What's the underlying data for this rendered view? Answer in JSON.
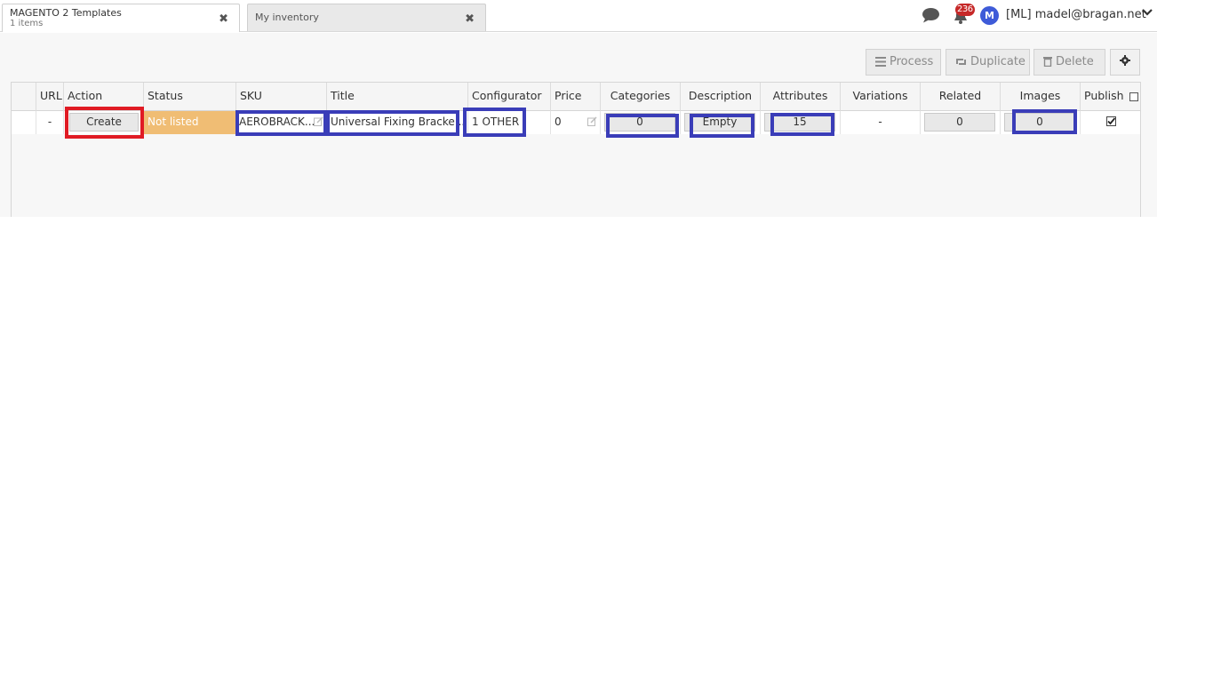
{
  "tabs": [
    {
      "title": "MAGENTO 2 Templates",
      "subtitle": "1 items"
    },
    {
      "title": "My inventory"
    }
  ],
  "header": {
    "notification_count": "236",
    "avatar_initial": "M",
    "user_label": "[ML] madel@bragan.net"
  },
  "toolbar": {
    "process_label": "Process",
    "duplicate_label": "Duplicate",
    "delete_label": "Delete"
  },
  "columns": {
    "url": "URL",
    "action": "Action",
    "status": "Status",
    "sku": "SKU",
    "title": "Title",
    "configurator": "Configurator",
    "price": "Price",
    "categories": "Categories",
    "description": "Description",
    "attributes": "Attributes",
    "variations": "Variations",
    "related": "Related",
    "images": "Images",
    "publish": "Publish"
  },
  "rows": [
    {
      "url": "-",
      "action": "Create",
      "status": "Not listed",
      "sku": "AEROBRACK...",
      "title": "Universal Fixing Bracke...",
      "configurator": "1 OTHER",
      "price": "0",
      "categories": "0",
      "description": "Empty",
      "attributes": "15",
      "variations": "-",
      "related": "0",
      "images": "0"
    }
  ],
  "colors": {
    "status_not_listed": "#f0bd74",
    "highlight_blue": "#3a3db8",
    "highlight_red": "#e01b24",
    "badge": "#c62828",
    "avatar": "#3e5bd8"
  }
}
